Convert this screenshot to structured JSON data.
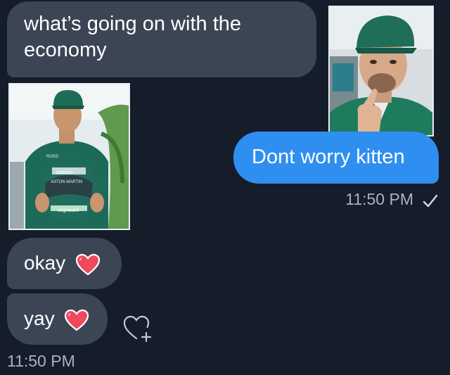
{
  "conversation": {
    "messages": [
      {
        "direction": "incoming",
        "text": "what’s going on with the economy"
      },
      {
        "direction": "outgoing",
        "text": "Dont worry kitten"
      },
      {
        "direction": "incoming",
        "text": "okay"
      },
      {
        "direction": "incoming",
        "text": "yay"
      }
    ],
    "outgoing_timestamp": "11:50 PM",
    "incoming_timestamp": "11:50 PM",
    "read_status_icon": "checkmark-icon",
    "reaction_icon": "heart-plus-icon",
    "emoji_icon": "red-heart-icon"
  },
  "photos": {
    "left_caption_text": [
      "ROSS",
      "aramco",
      "ASTON MARTIN",
      "cognizant"
    ]
  },
  "colors": {
    "background": "#161d2a",
    "incoming_bubble": "#3b4554",
    "outgoing_bubble": "#2f8ff0",
    "heart": "#f0485c",
    "timestamp": "#aab2be"
  }
}
